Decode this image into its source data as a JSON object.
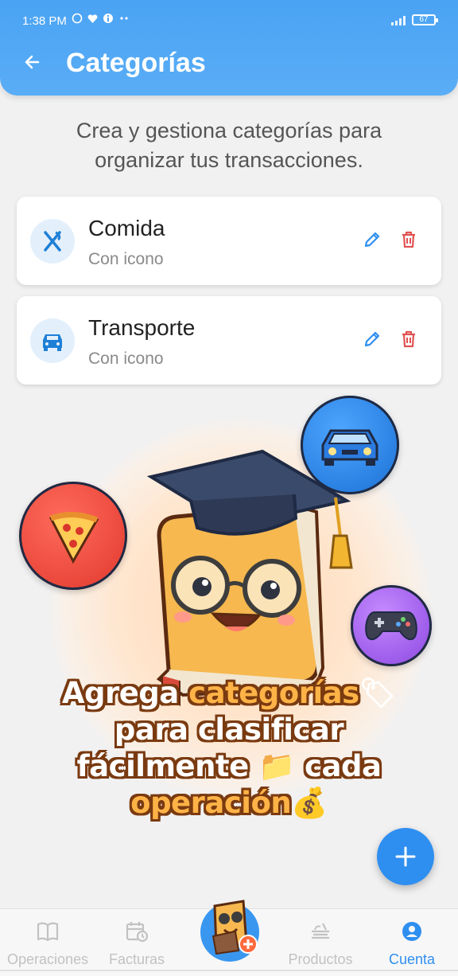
{
  "status_bar": {
    "time": "1:38 PM",
    "battery": "67"
  },
  "header": {
    "title": "Categorías"
  },
  "intro": "Crea y gestiona categorías para organizar tus transacciones.",
  "categories": [
    {
      "name": "Comida",
      "subtitle": "Con icono",
      "icon": "restaurant-icon"
    },
    {
      "name": "Transporte",
      "subtitle": "Con icono",
      "icon": "car-icon"
    }
  ],
  "promo": {
    "line1_a": "Agrega ",
    "line1_b": "categorías",
    "line1_emoji": "🏷",
    "line2": "para clasificar",
    "line3_a": "fácilmente ",
    "line3_emoji": "📁",
    "line3_b": " cada",
    "line4": "operación",
    "line4_emoji": "💰"
  },
  "bottom_nav": [
    {
      "label": "Operaciones",
      "icon": "book-icon",
      "active": false
    },
    {
      "label": "Facturas",
      "icon": "calendar-clock-icon",
      "active": false
    },
    {
      "label": "Productos",
      "icon": "food-tray-icon",
      "active": false
    },
    {
      "label": "Cuenta",
      "icon": "account-icon",
      "active": true
    }
  ],
  "colors": {
    "primary": "#4aa3f3",
    "accent": "#2f8ff0",
    "delete": "#e05252"
  }
}
